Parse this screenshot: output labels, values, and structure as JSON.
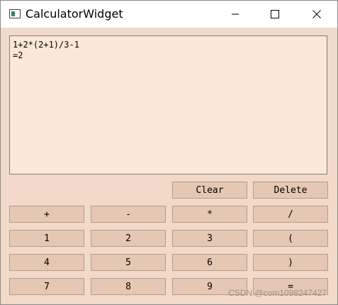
{
  "window": {
    "title": "CalculatorWidget"
  },
  "display": {
    "expression": "1+2*(2+1)/3-1",
    "result": "=2"
  },
  "buttons": {
    "clear": "Clear",
    "delete": "Delete",
    "plus": "+",
    "minus": "-",
    "multiply": "*",
    "divide": "/",
    "one": "1",
    "two": "2",
    "three": "3",
    "open_paren": "(",
    "four": "4",
    "five": "5",
    "six": "6",
    "close_paren": ")",
    "seven": "7",
    "eight": "8",
    "nine": "9",
    "equals": "="
  },
  "watermark": "CSDN @com1098247427",
  "colors": {
    "background": "#f1dac9",
    "display_bg": "#fde7d6",
    "button_bg": "#e4c8b4"
  }
}
